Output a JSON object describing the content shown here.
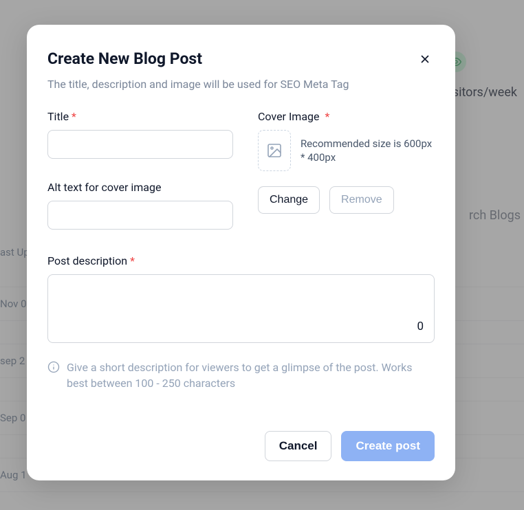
{
  "background": {
    "stat_text": "sitors/week",
    "search_text": "rch Blogs",
    "header_text": "ast Up",
    "rows": [
      "Nov 0",
      "sep 2",
      "Sep 0",
      "Aug 1"
    ]
  },
  "modal": {
    "title": "Create New Blog Post",
    "subtitle": "The title, description and image will be used for SEO Meta Tag",
    "title_field": {
      "label": "Title",
      "value": ""
    },
    "alt_text_field": {
      "label": "Alt text for cover image",
      "value": ""
    },
    "cover_image": {
      "label": "Cover Image",
      "hint": "Recommended size is 600px * 400px",
      "change_btn": "Change",
      "remove_btn": "Remove"
    },
    "description": {
      "label": "Post description",
      "value": "",
      "char_count": "0",
      "hint": "Give a short description for viewers to get a glimpse of the post. Works best between 100 - 250 characters"
    },
    "footer": {
      "cancel": "Cancel",
      "create": "Create post"
    }
  }
}
